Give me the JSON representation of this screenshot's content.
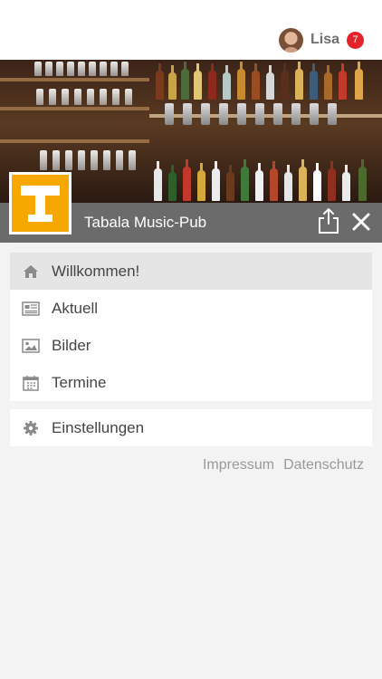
{
  "user": {
    "name": "Lisa",
    "notification_count": "7"
  },
  "header": {
    "title": "Tabala Music-Pub"
  },
  "menu": {
    "items": [
      {
        "label": "Willkommen!",
        "icon": "home-icon",
        "active": true
      },
      {
        "label": "Aktuell",
        "icon": "newspaper-icon",
        "active": false
      },
      {
        "label": "Bilder",
        "icon": "image-icon",
        "active": false
      },
      {
        "label": "Termine",
        "icon": "calendar-icon",
        "active": false
      }
    ],
    "settings": {
      "label": "Einstellungen",
      "icon": "gear-icon"
    }
  },
  "footer": {
    "impressum": "Impressum",
    "datenschutz": "Datenschutz"
  },
  "colors": {
    "title_bar": "#6b6b6b",
    "logo_background": "#f7a800",
    "badge": "#e4222a",
    "active_item": "#e5e5e5"
  }
}
